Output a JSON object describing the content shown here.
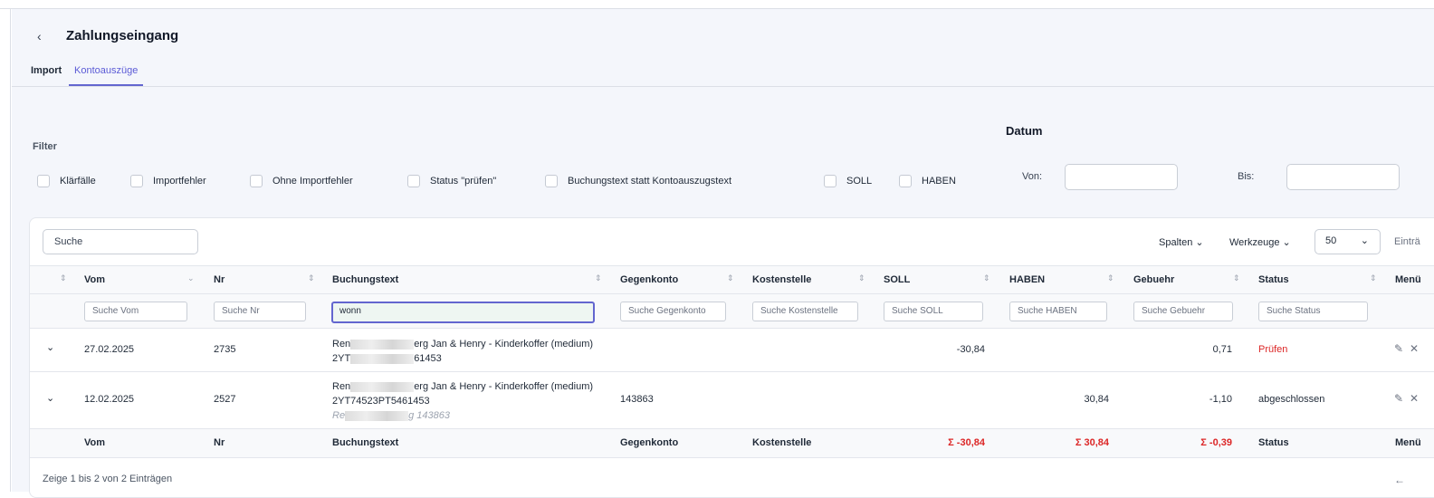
{
  "header": {
    "back": "‹",
    "title": "Zahlungseingang"
  },
  "tabs": [
    {
      "label": "Import"
    },
    {
      "label": "Kontoauszüge",
      "active": true
    }
  ],
  "filter": {
    "label": "Filter",
    "checkboxes": [
      "Klärfälle",
      "Importfehler",
      "Ohne Importfehler",
      "Status \"prüfen\"",
      "Buchungstext statt Kontoauszugstext",
      "SOLL",
      "HABEN"
    ]
  },
  "datum": {
    "title": "Datum",
    "von": "Von:",
    "bis": "Bis:"
  },
  "toolbar": {
    "search_placeholder": "Suche",
    "spalten": "Spalten",
    "werkzeuge": "Werkzeuge",
    "page_size": "50",
    "entries": "Einträ"
  },
  "columns": [
    "Vom",
    "Nr",
    "Buchungstext",
    "Gegenkonto",
    "Kostenstelle",
    "SOLL",
    "HABEN",
    "Gebuehr",
    "Status",
    "Menü"
  ],
  "filters": {
    "vom": "Suche Vom",
    "nr": "Suche Nr",
    "buchungstext": "wonn",
    "gegenkonto": "Suche Gegenkonto",
    "kostenstelle": "Suche Kostenstelle",
    "soll": "Suche SOLL",
    "haben": "Suche HABEN",
    "gebuehr": "Suche Gebuehr",
    "status": "Suche Status"
  },
  "rows": [
    {
      "vom": "27.02.2025",
      "nr": "2735",
      "text_a": "Ren",
      "text_b": "erg Jan & Henry - Kinderkoffer (medium)",
      "text2_a": "2YT",
      "text2_b": "61453",
      "gegenkonto": "",
      "soll": "-30,84",
      "haben": "",
      "gebuehr": "0,71",
      "status": "Prüfen"
    },
    {
      "vom": "12.02.2025",
      "nr": "2527",
      "text_a": "Ren",
      "text_b": "erg Jan & Henry - Kinderkoffer (medium)",
      "text2": "2YT74523PT5461453",
      "text3_a": "Re",
      "text3_b": "g 143863",
      "gegenkonto": "143863",
      "soll": "",
      "haben": "30,84",
      "gebuehr": "-1,10",
      "status": "abgeschlossen"
    }
  ],
  "footer": {
    "soll": "Σ -30,84",
    "haben": "Σ 30,84",
    "gebuehr": "Σ -0,39"
  },
  "pagination": {
    "info": "Zeige 1 bis 2 von 2 Einträgen",
    "prev": "←"
  },
  "colors": {
    "accent": "#6366cf",
    "danger": "#dc2626"
  }
}
